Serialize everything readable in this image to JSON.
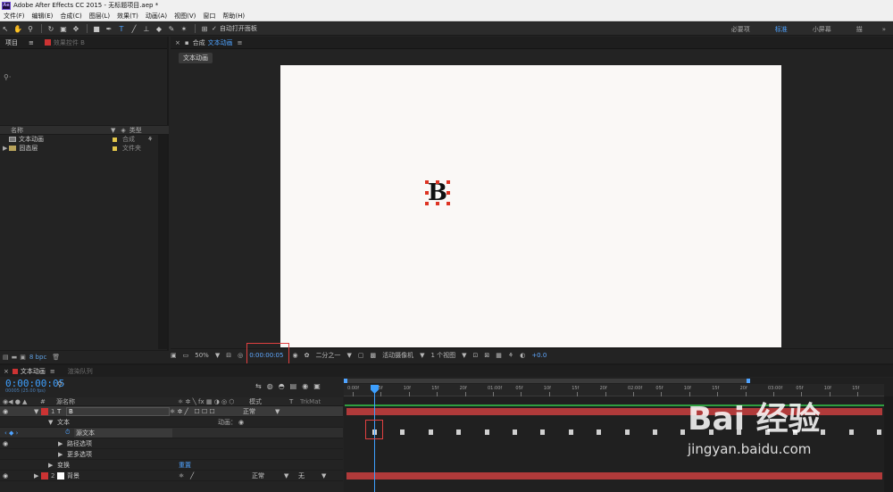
{
  "window": {
    "title": "Adobe After Effects CC 2015 - 无标题项目.aep *",
    "logo": "Ae"
  },
  "menu": [
    "文件(F)",
    "编辑(E)",
    "合成(C)",
    "图层(L)",
    "效果(T)",
    "动画(A)",
    "视图(V)",
    "窗口",
    "帮助(H)"
  ],
  "toolbar": {
    "auto_open_label": "自动打开面板",
    "workspaces": [
      "必要项",
      "标准",
      "小屏幕",
      "描"
    ],
    "current_workspace": "标准",
    "more": "»"
  },
  "project": {
    "tab_project": "项目",
    "tab_effects": "效果控件 B",
    "col_name": "名称",
    "col_type": "类型",
    "items": [
      {
        "name": "文本动画",
        "type": "合成"
      },
      {
        "name": "固态层",
        "type": "文件夹"
      }
    ],
    "bpc": "8 bpc"
  },
  "comp": {
    "tab_label": "合成",
    "comp_name": "文本动画",
    "sub_tab": "文本动画",
    "glyph": "B",
    "footer": {
      "zoom": "50%",
      "timecode": "0:00:00:05",
      "resolution": "二分之一",
      "camera": "活动摄像机",
      "views": "1 个视图",
      "exposure": "+0.0"
    }
  },
  "timeline": {
    "tab_comp": "文本动画",
    "tab_render": "渲染队列",
    "current_time": "0:00:00:05",
    "fps_label": "00005 (25.00 fps)",
    "col_source": "源名称",
    "col_mode": "模式",
    "col_trkmat": "TrkMat",
    "layers": [
      {
        "name": "B",
        "mode": "正常",
        "num": "1"
      },
      {
        "name": "文本",
        "extra": "动画："
      },
      {
        "name": "源文本"
      },
      {
        "name": "路径选项"
      },
      {
        "name": "更多选项"
      },
      {
        "name": "变换",
        "extra": "重置"
      },
      {
        "name": "背景",
        "mode": "正常",
        "trkmat": "无",
        "num": "2"
      }
    ],
    "ruler": [
      "0:00f",
      "05f",
      "10f",
      "15f",
      "20f",
      "01:00f",
      "05f",
      "10f",
      "15f",
      "20f",
      "02:00f",
      "05f",
      "10f",
      "15f",
      "20f",
      "03:00f",
      "05f",
      "10f",
      "15f"
    ]
  },
  "watermark": {
    "logo": "Bai 经验",
    "url": "jingyan.baidu.com"
  }
}
